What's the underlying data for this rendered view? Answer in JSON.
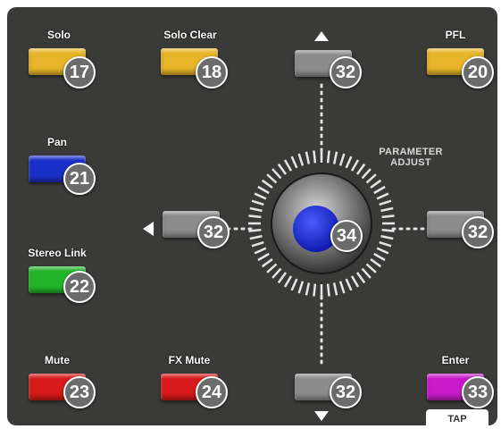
{
  "buttons": {
    "solo": {
      "label": "Solo",
      "number": "17",
      "color": "#e8b52a"
    },
    "solo_clear": {
      "label": "Solo Clear",
      "number": "18",
      "color": "#e8b52a"
    },
    "pfl": {
      "label": "PFL",
      "number": "20",
      "color": "#e8b52a"
    },
    "pan": {
      "label": "Pan",
      "number": "21",
      "color": "#1a2fc8"
    },
    "stereo_link": {
      "label": "Stereo Link",
      "number": "22",
      "color": "#22b52a"
    },
    "mute": {
      "label": "Mute",
      "number": "23",
      "color": "#d81a1a"
    },
    "fx_mute": {
      "label": "FX Mute",
      "number": "24",
      "color": "#d81a1a"
    },
    "enter": {
      "label": "Enter",
      "number": "33",
      "color": "#c81ac8"
    }
  },
  "nav": {
    "up": {
      "number": "32",
      "color": "#8c8c8c"
    },
    "left": {
      "number": "32",
      "color": "#8c8c8c"
    },
    "right": {
      "number": "32",
      "color": "#8c8c8c"
    },
    "down": {
      "number": "32",
      "color": "#8c8c8c"
    }
  },
  "dial": {
    "number": "34",
    "color": "#1e2ad8"
  },
  "parameter_label": {
    "line1": "PARAMETER",
    "line2": "ADJUST"
  },
  "tap_label": "TAP"
}
